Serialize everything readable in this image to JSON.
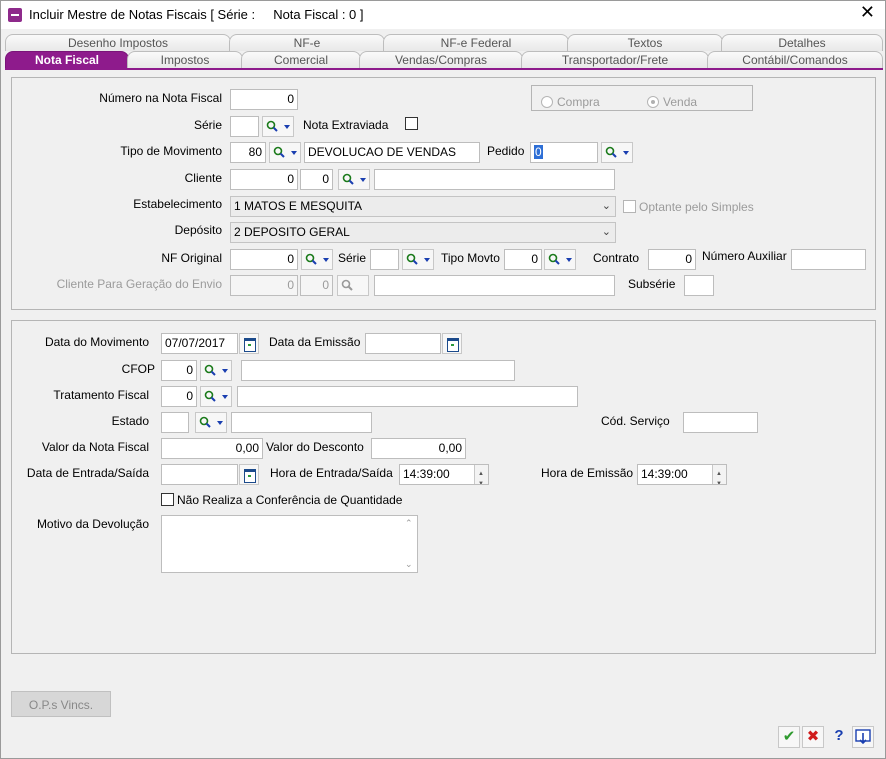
{
  "window": {
    "title": "Incluir Mestre de Notas Fiscais [ Série :     Nota Fiscal : 0 ]"
  },
  "tabs_row1": [
    "Desenho Impostos",
    "NF-e",
    "NF-e Federal",
    "Textos",
    "Detalhes"
  ],
  "tabs_row2": [
    "Nota Fiscal",
    "Impostos",
    "Comercial",
    "Vendas/Compras",
    "Transportador/Frete",
    "Contábil/Comandos"
  ],
  "active_tab": "Nota Fiscal",
  "colors": {
    "accent": "#8e1b8c",
    "check": "#2e9a2e",
    "cancel": "#d01c1c",
    "help": "#1a3fb0"
  },
  "top": {
    "numero_nf": {
      "label": "Número na Nota Fiscal",
      "value": "0"
    },
    "serie": {
      "label": "Série",
      "value": ""
    },
    "nota_extraviada": {
      "label": "Nota Extraviada",
      "checked": false
    },
    "tipo_movimento": {
      "label": "Tipo de Movimento",
      "code": "80",
      "desc": "DEVOLUCAO DE VENDAS"
    },
    "pedido": {
      "label": "Pedido",
      "value": "0"
    },
    "cliente": {
      "label": "Cliente",
      "code": "0",
      "code2": "0",
      "name": ""
    },
    "estabelecimento": {
      "label": "Estabelecimento",
      "value": "1 MATOS E MESQUITA"
    },
    "optante": {
      "label": "Optante pelo Simples",
      "checked": false
    },
    "deposito": {
      "label": "Depósito",
      "value": "2 DEPOSITO GERAL"
    },
    "nf_original": {
      "label": "NF Original",
      "value": "0"
    },
    "serie2": {
      "label": "Série",
      "value": ""
    },
    "tipo_movto": {
      "label": "Tipo Movto",
      "value": "0"
    },
    "contrato": {
      "label": "Contrato",
      "value": "0"
    },
    "numero_auxiliar": {
      "label": "Número Auxiliar",
      "value": ""
    },
    "cliente_envio": {
      "label": "Cliente Para Geração do Envio",
      "code": "0",
      "code2": "0",
      "name": ""
    },
    "subserie": {
      "label": "Subsérie",
      "value": ""
    },
    "operacao": {
      "compra": "Compra",
      "venda": "Venda",
      "selected": "Venda"
    }
  },
  "bottom": {
    "data_movimento": {
      "label": "Data do Movimento",
      "value": "07/07/2017"
    },
    "data_emissao": {
      "label": "Data da Emissão",
      "value": ""
    },
    "cfop": {
      "label": "CFOP",
      "code": "0",
      "desc": ""
    },
    "tratamento_fiscal": {
      "label": "Tratamento Fiscal",
      "code": "0",
      "desc": ""
    },
    "estado": {
      "label": "Estado",
      "code": "",
      "desc": ""
    },
    "cod_servico": {
      "label": "Cód. Serviço",
      "value": ""
    },
    "valor_nf": {
      "label": "Valor da Nota Fiscal",
      "value": "0,00"
    },
    "valor_desconto": {
      "label": "Valor do Desconto",
      "value": "0,00"
    },
    "data_entrada_saida": {
      "label": "Data de Entrada/Saída",
      "value": ""
    },
    "hora_entrada_saida": {
      "label": "Hora de Entrada/Saída",
      "value": "14:39:00"
    },
    "hora_emissao": {
      "label": "Hora de Emissão",
      "value": "14:39:00"
    },
    "nao_realiza": {
      "label": "Não Realiza a Conferência de Quantidade",
      "checked": false
    },
    "motivo_devolucao": {
      "label": "Motivo da Devolução",
      "value": ""
    }
  },
  "buttons": {
    "ops_vincs": "O.P.s Vincs.",
    "ok_icon": "check-icon",
    "cancel_icon": "cancel-x-icon",
    "help": "?",
    "export_icon": "export-icon"
  }
}
